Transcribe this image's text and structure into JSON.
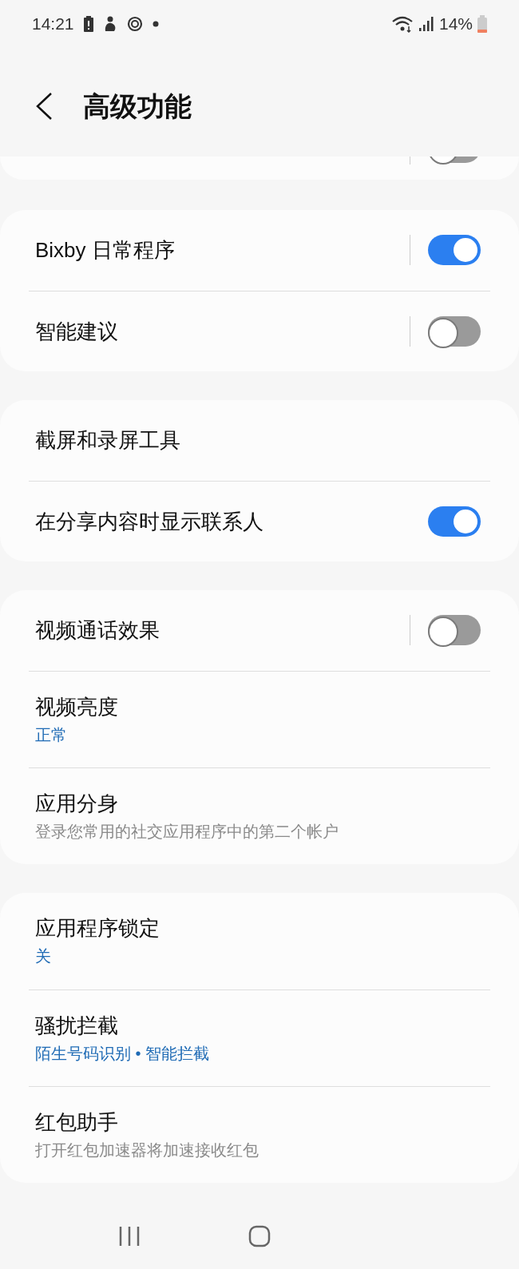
{
  "status_bar": {
    "time": "14:21",
    "battery": "14%"
  },
  "header": {
    "title": "高级功能"
  },
  "partial_card": {
    "toggle_on": false,
    "split": true
  },
  "groups": [
    {
      "rows": [
        {
          "kind": "toggle",
          "title": "Bixby 日常程序",
          "on": true,
          "split": true
        },
        {
          "kind": "toggle",
          "title": "智能建议",
          "on": false,
          "split": true
        }
      ]
    },
    {
      "rows": [
        {
          "kind": "plain",
          "title": "截屏和录屏工具"
        },
        {
          "kind": "toggle",
          "title": "在分享内容时显示联系人",
          "on": true,
          "split": false
        }
      ]
    },
    {
      "rows": [
        {
          "kind": "toggle",
          "title": "视频通话效果",
          "on": false,
          "split": true
        },
        {
          "kind": "value",
          "title": "视频亮度",
          "value": "正常"
        },
        {
          "kind": "summary",
          "title": "应用分身",
          "summary": "登录您常用的社交应用程序中的第二个帐户"
        }
      ]
    },
    {
      "rows": [
        {
          "kind": "value",
          "title": "应用程序锁定",
          "value": "关"
        },
        {
          "kind": "value",
          "title": "骚扰拦截",
          "value": "陌生号码识别 • 智能拦截"
        },
        {
          "kind": "summary",
          "title": "红包助手",
          "summary": "打开红包加速器将加速接收红包"
        }
      ]
    }
  ]
}
